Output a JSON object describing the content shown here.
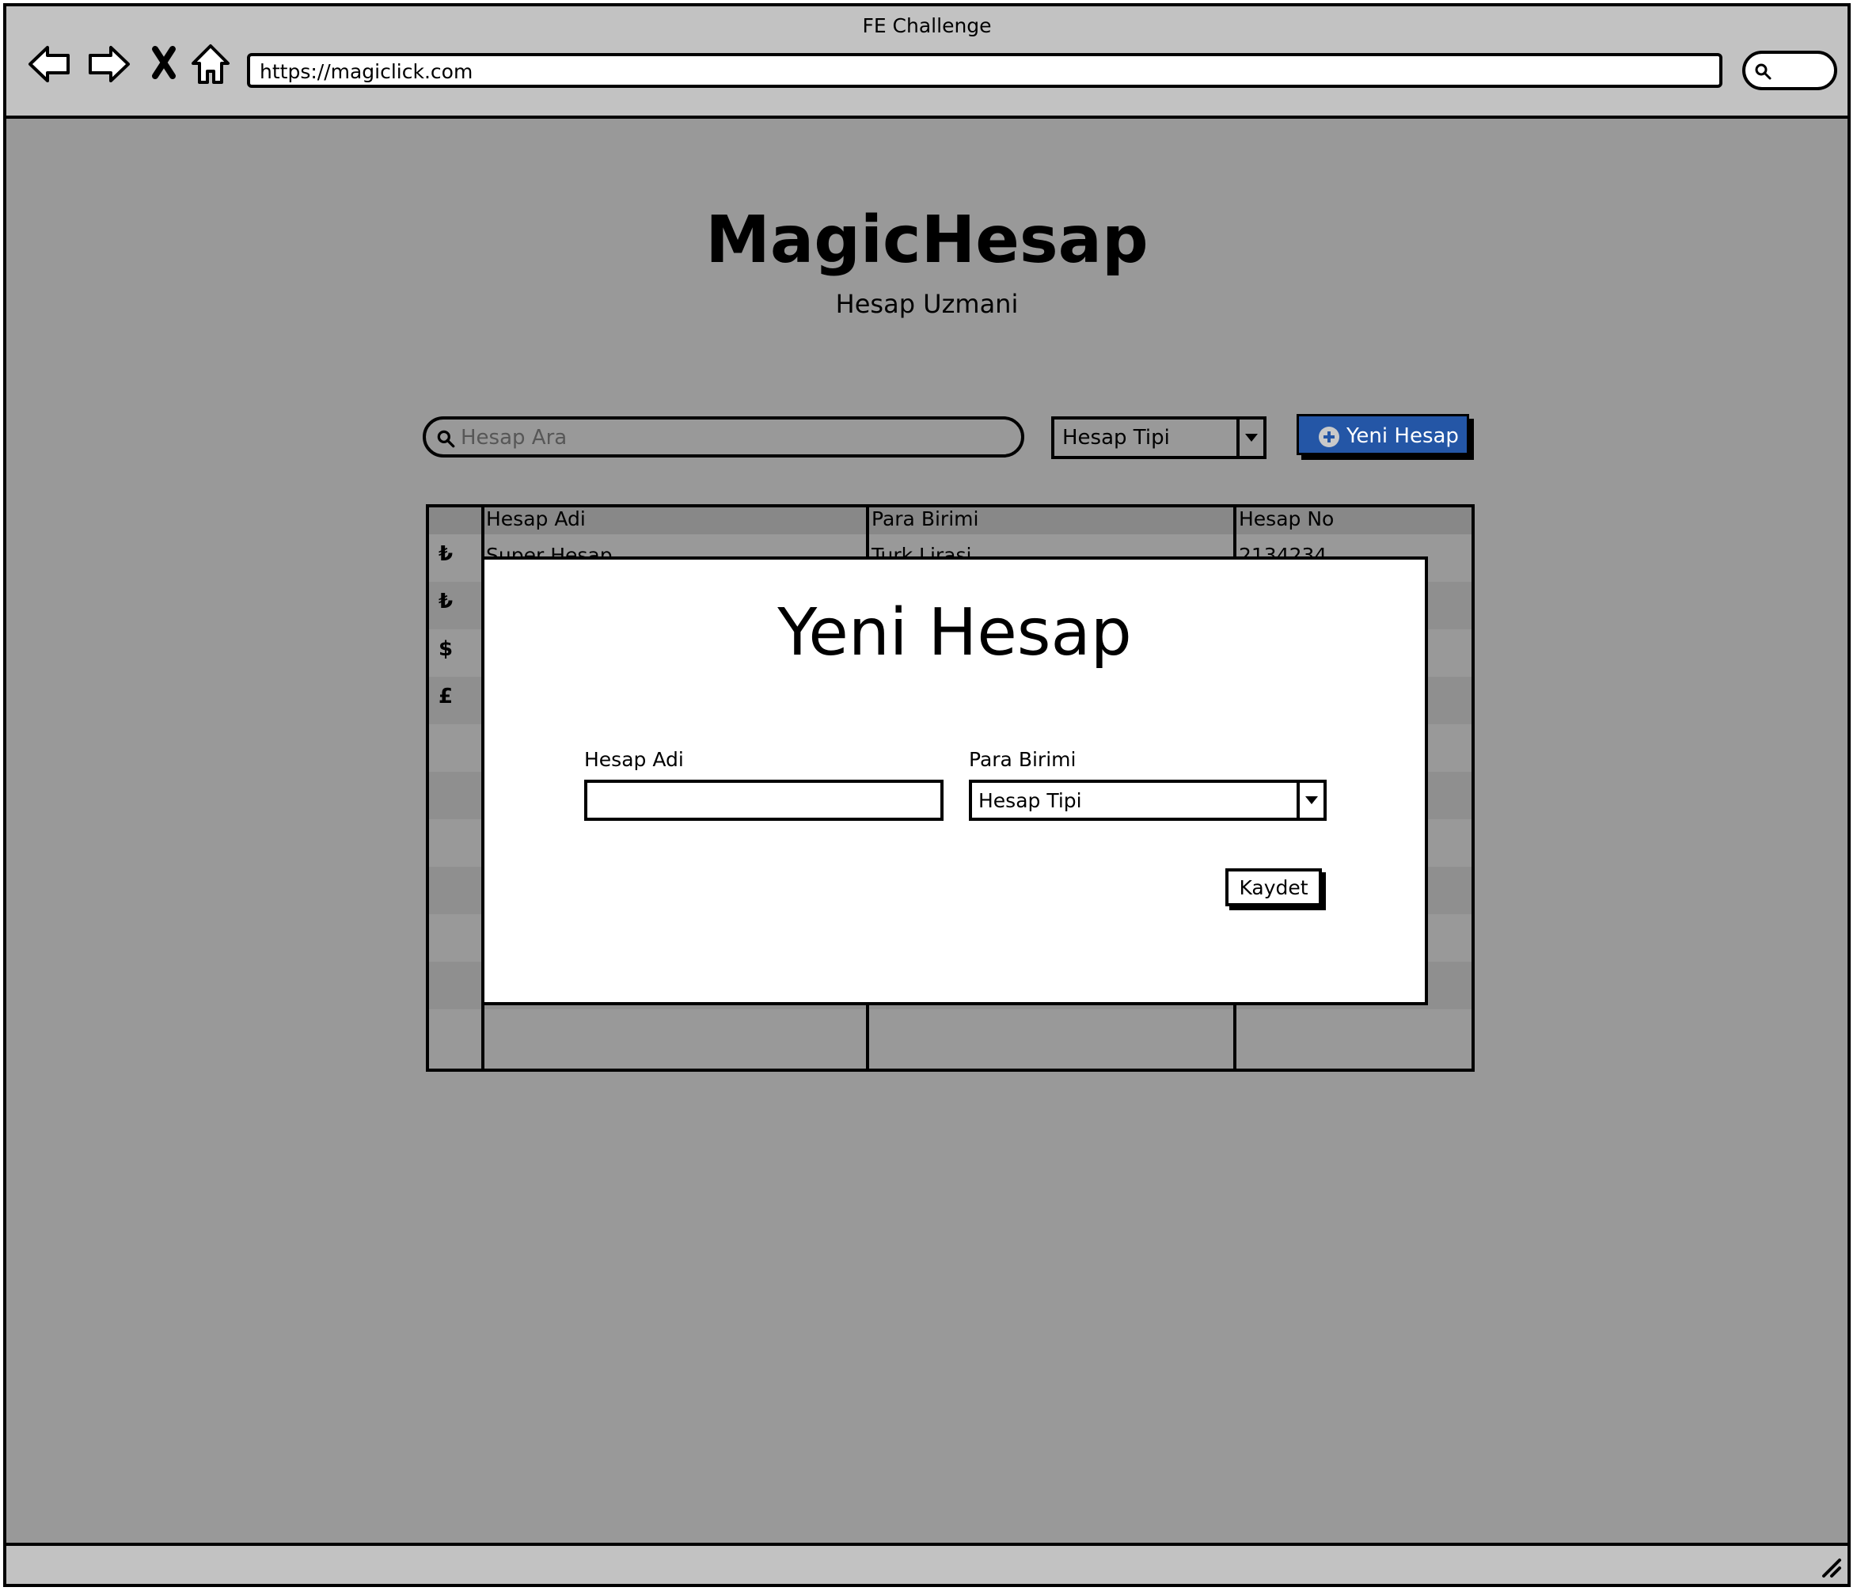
{
  "browser": {
    "window_title": "FE Challenge",
    "url": "https://magiclick.com"
  },
  "app": {
    "title": "MagicHesap",
    "subtitle": "Hesap Uzmani"
  },
  "toolbar": {
    "search_placeholder": "Hesap Ara",
    "type_select_value": "Hesap Tipi",
    "new_button_label": "Yeni Hesap",
    "new_button_color": "#2456a6"
  },
  "table": {
    "columns": [
      "Hesap Adi",
      "Para Birimi",
      "Hesap No"
    ],
    "rows": [
      {
        "icon": "₺",
        "name": "Super Hesap",
        "currency": "Turk Lirasi",
        "number": "2134234"
      },
      {
        "icon": "₺"
      },
      {
        "icon": "$"
      },
      {
        "icon": "£"
      }
    ]
  },
  "modal": {
    "title": "Yeni Hesap",
    "name_label": "Hesap Adi",
    "name_value": "",
    "currency_label": "Para Birimi",
    "currency_select_value": "Hesap Tipi",
    "save_label": "Kaydet"
  }
}
